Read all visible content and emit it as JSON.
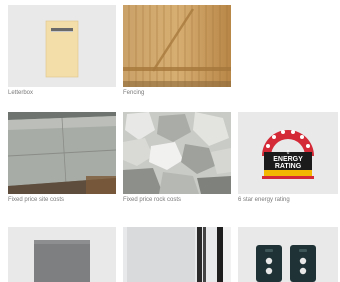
{
  "tiles": [
    {
      "caption": "Letterbox",
      "image": "letterbox-panel-icon"
    },
    {
      "caption": "Fencing",
      "image": "timber-fence-icon"
    },
    {
      "caption": "Fixed price site costs",
      "image": "concrete-slab-icon"
    },
    {
      "caption": "Fixed price rock costs",
      "image": "rock-rubble-icon"
    },
    {
      "caption": "6 star energy rating",
      "image": "energy-rating-badge-icon"
    },
    {
      "caption": "",
      "image": "grey-panel-icon"
    },
    {
      "caption": "",
      "image": "glass-door-icon"
    },
    {
      "caption": "",
      "image": "remote-fob-icon"
    }
  ],
  "energy_badge": {
    "line1": "ENERGY",
    "line2": "RATING",
    "stars_text": "6"
  },
  "colors": {
    "tile_background": "#e9e9ea",
    "badge_red": "#d42a37",
    "badge_black": "#1b1b1b",
    "badge_yellow": "#f2b700"
  }
}
